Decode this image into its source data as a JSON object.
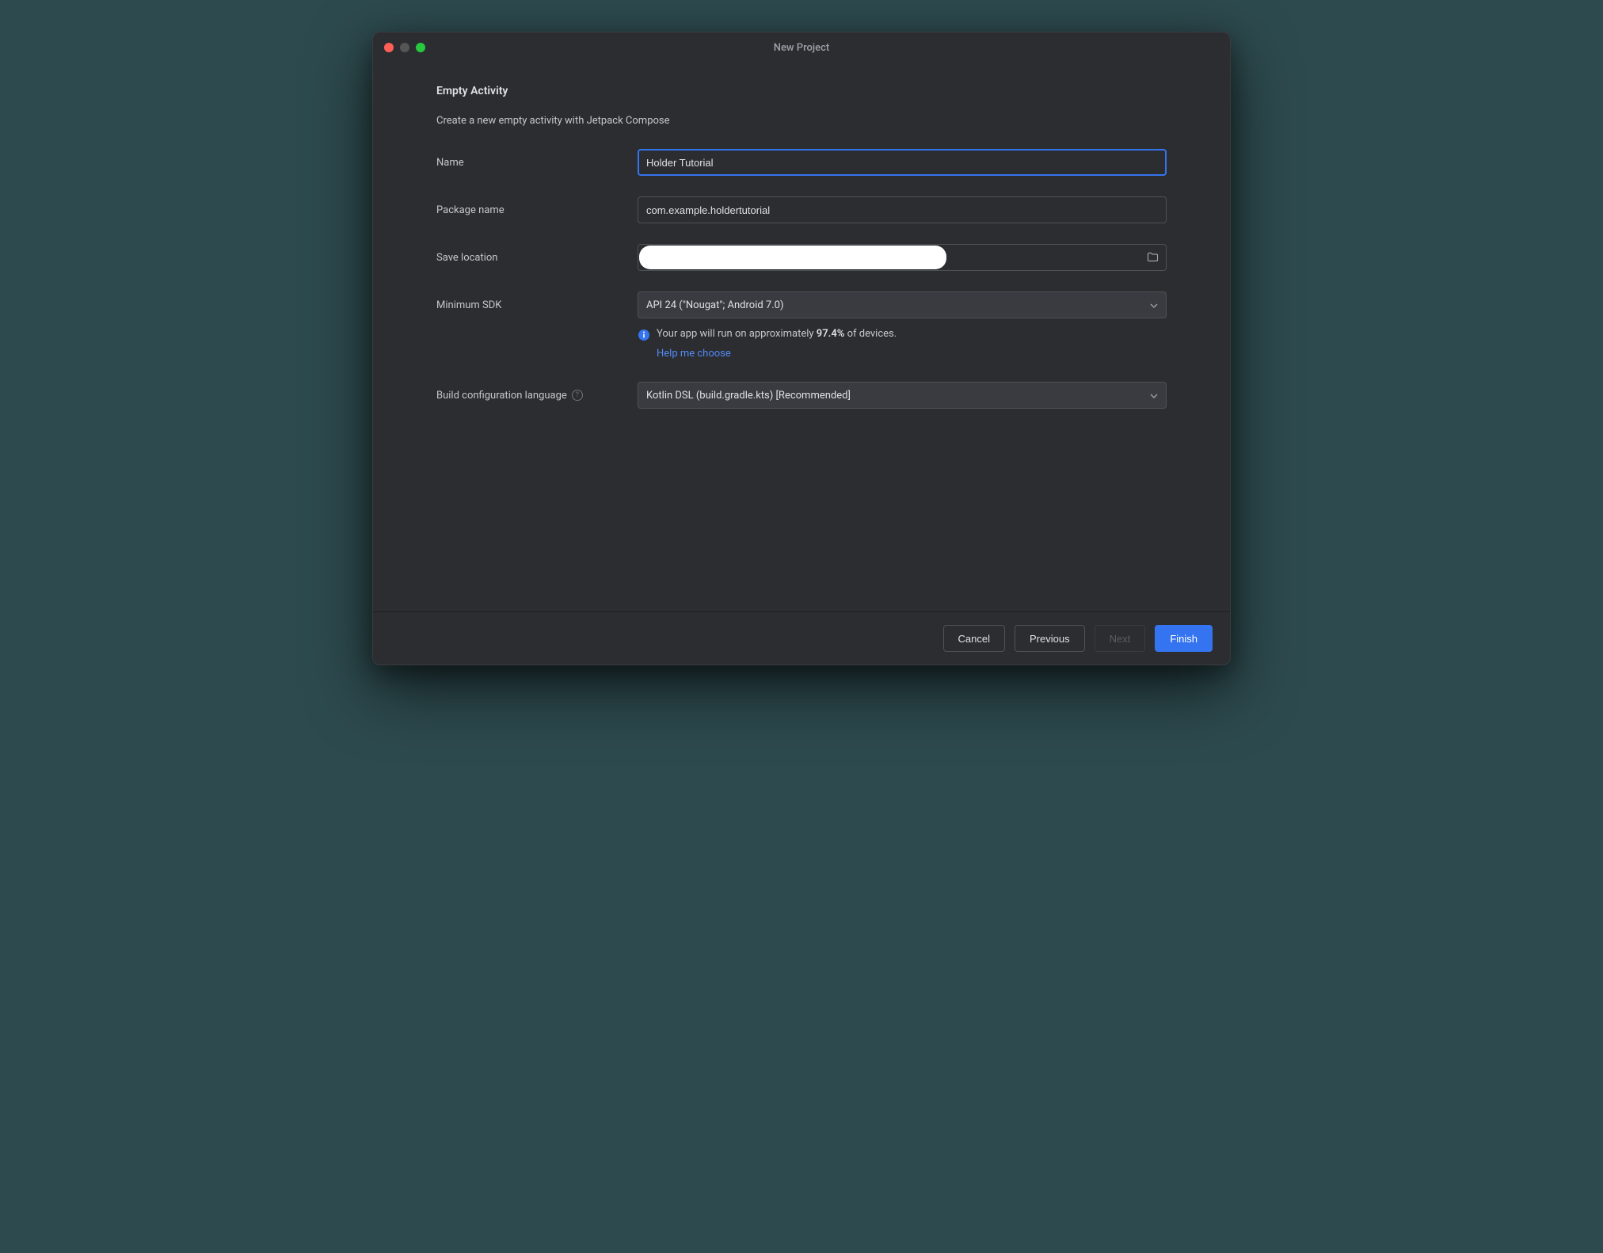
{
  "window": {
    "title": "New Project"
  },
  "section": {
    "title": "Empty Activity",
    "description": "Create a new empty activity with Jetpack Compose"
  },
  "fields": {
    "name": {
      "label": "Name",
      "value": "Holder Tutorial"
    },
    "package_name": {
      "label": "Package name",
      "value": "com.example.holdertutorial"
    },
    "save_location": {
      "label": "Save location",
      "value": ""
    },
    "minimum_sdk": {
      "label": "Minimum SDK",
      "value": "API 24 (\"Nougat\"; Android 7.0)"
    },
    "build_config": {
      "label": "Build configuration language",
      "value": "Kotlin DSL (build.gradle.kts) [Recommended]"
    }
  },
  "info": {
    "text_before": "Your app will run on approximately ",
    "percentage": "97.4%",
    "text_after": " of devices.",
    "help_link": "Help me choose"
  },
  "buttons": {
    "cancel": "Cancel",
    "previous": "Previous",
    "next": "Next",
    "finish": "Finish"
  }
}
